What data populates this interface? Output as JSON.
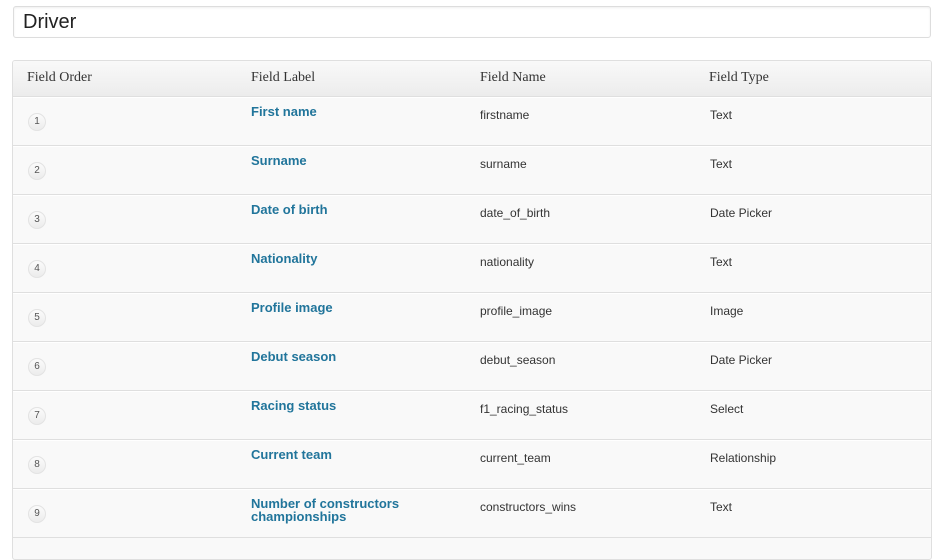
{
  "post_title": "Driver",
  "table": {
    "headers": {
      "order": "Field Order",
      "label": "Field Label",
      "name": "Field Name",
      "type": "Field Type"
    },
    "rows": [
      {
        "order": "1",
        "label": "First name",
        "name": "firstname",
        "type": "Text"
      },
      {
        "order": "2",
        "label": "Surname",
        "name": "surname",
        "type": "Text"
      },
      {
        "order": "3",
        "label": "Date of birth",
        "name": "date_of_birth",
        "type": "Date Picker"
      },
      {
        "order": "4",
        "label": "Nationality",
        "name": "nationality",
        "type": "Text"
      },
      {
        "order": "5",
        "label": "Profile image",
        "name": "profile_image",
        "type": "Image"
      },
      {
        "order": "6",
        "label": "Debut season",
        "name": "debut_season",
        "type": "Date Picker"
      },
      {
        "order": "7",
        "label": "Racing status",
        "name": "f1_racing_status",
        "type": "Select"
      },
      {
        "order": "8",
        "label": "Current team",
        "name": "current_team",
        "type": "Relationship"
      },
      {
        "order": "9",
        "label": "Number of constructors championships",
        "name": "constructors_wins",
        "type": "Text"
      }
    ]
  },
  "colors": {
    "link": "#21759b",
    "row_bg": "#f9f9f9",
    "border": "#dfdfdf"
  }
}
